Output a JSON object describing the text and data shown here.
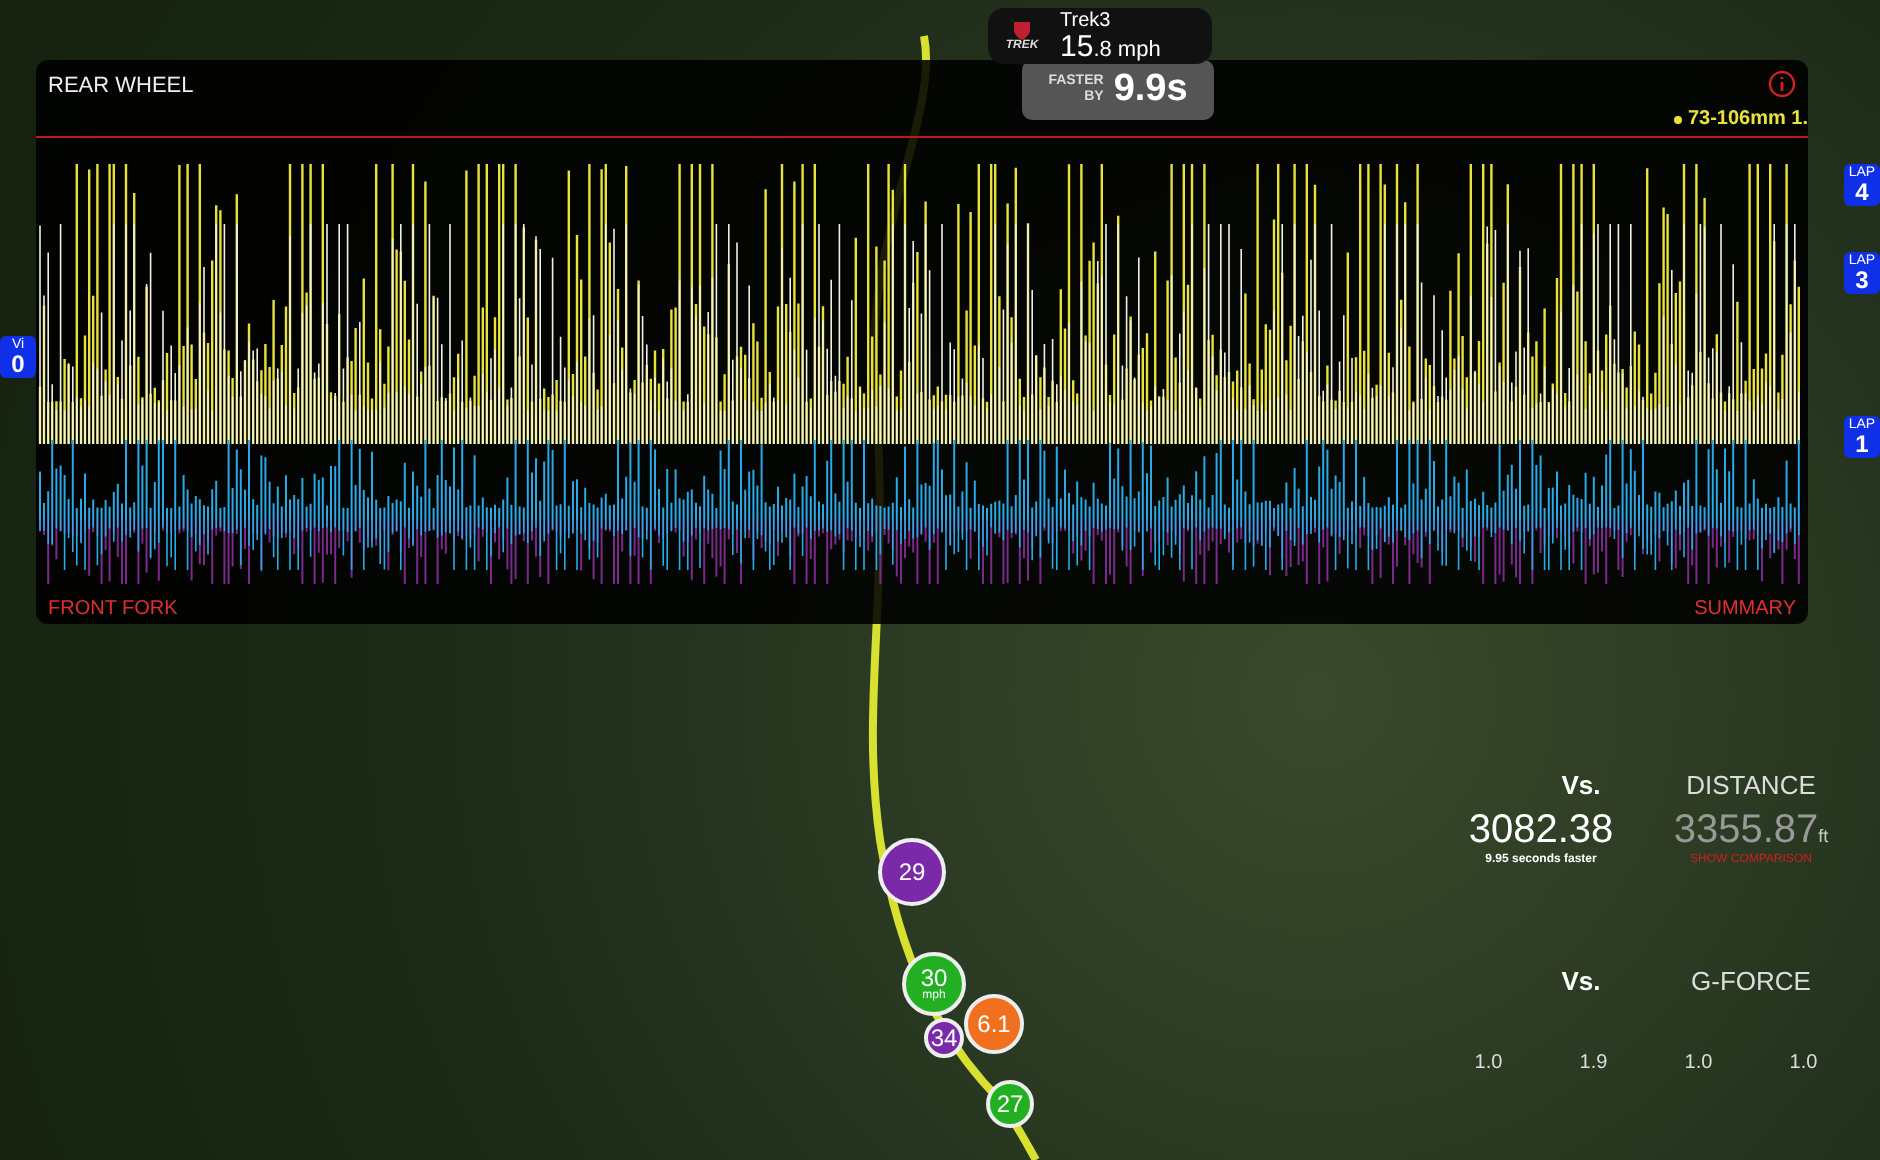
{
  "rider": {
    "logo": "TREK",
    "name": "Trek3",
    "speed": "15",
    "speed_decimal": ".8 mph"
  },
  "gap": {
    "label_top": "FASTER",
    "label_bottom": "BY",
    "value": "9.9s"
  },
  "panel": {
    "title": "REAR WHEEL",
    "legend": "73-106mm 1.",
    "bottom_left": "FRONT FORK",
    "bottom_right": "SUMMARY"
  },
  "left_badges": [
    {
      "label": "Vi",
      "value": "0"
    }
  ],
  "lap_badges": [
    {
      "label": "LAP",
      "value": "4"
    },
    {
      "label": "LAP",
      "value": "3"
    },
    {
      "label": "LAP",
      "value": "1"
    }
  ],
  "markers": [
    {
      "value": "29",
      "color": "#7a2aa8"
    },
    {
      "value": "30",
      "unit": "mph",
      "color": "#22b022"
    },
    {
      "value": "6.1",
      "color": "#f07020"
    },
    {
      "value": "34",
      "color": "#7a2aa8"
    },
    {
      "value": "27",
      "color": "#22b022"
    }
  ],
  "stats": {
    "distance": {
      "vs": "Vs.",
      "title": "DISTANCE",
      "value": "3082.38",
      "note": "9.95 seconds faster",
      "compare": "3355.87",
      "unit": "ft",
      "link": "SHOW COMPARISON"
    },
    "gforce": {
      "vs": "Vs.",
      "title": "G-FORCE",
      "values": [
        "1.0",
        "1.9",
        "1.0",
        "1.0"
      ]
    }
  }
}
